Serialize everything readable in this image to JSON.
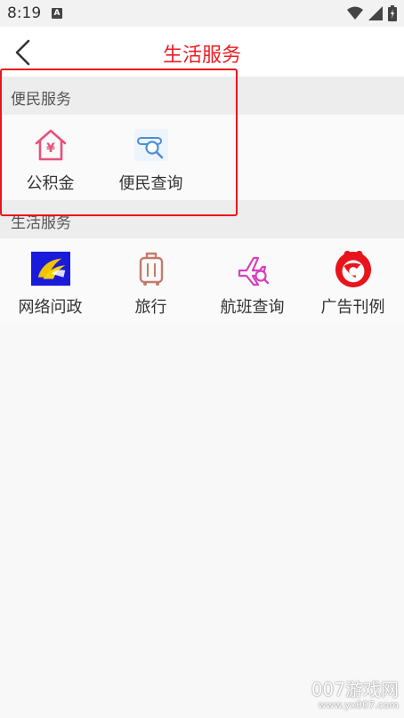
{
  "status_bar": {
    "time": "8:19",
    "notification_glyph": "A"
  },
  "navbar": {
    "title": "生活服务",
    "back_icon": "chevron-left-icon",
    "title_color": "#ee1c25"
  },
  "sections": [
    {
      "title": "便民服务",
      "items": [
        {
          "label": "公积金",
          "icon": "house-yen-icon"
        },
        {
          "label": "便民查询",
          "icon": "search-query-icon"
        }
      ]
    },
    {
      "title": "生活服务",
      "items": [
        {
          "label": "网络问政",
          "icon": "network-politics-icon"
        },
        {
          "label": "旅行",
          "icon": "luggage-icon"
        },
        {
          "label": "航班查询",
          "icon": "flight-search-icon"
        },
        {
          "label": "广告刊例",
          "icon": "ad-logo-icon"
        }
      ]
    }
  ],
  "watermark": {
    "line1": "007游戏网",
    "line2": "www.yx007.com"
  },
  "colors": {
    "accent": "#ee1c25",
    "pink": "#e8507a",
    "blue": "#4a8fd8",
    "magenta": "#d63fbf",
    "brown": "#c57a6a"
  }
}
